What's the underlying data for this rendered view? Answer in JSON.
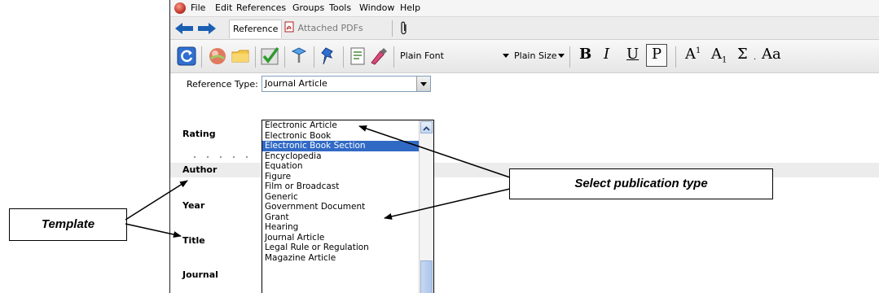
{
  "menubar": {
    "items": [
      "File",
      "Edit",
      "References",
      "Groups",
      "Tools",
      "Window",
      "Help"
    ]
  },
  "tabs": {
    "reference": "Reference",
    "attached_pdfs": "Attached PDFs"
  },
  "toolbar": {
    "font": "Plain Font",
    "size": "Plain Size",
    "bold": "B",
    "italic": "I",
    "underline": "U",
    "plain": "P",
    "superscript_base": "A",
    "superscript_mark": "1",
    "subscript_base": "A",
    "subscript_mark": "1",
    "symbol": "Σ",
    "case": "Aa"
  },
  "reference_type": {
    "label": "Reference Type:",
    "value": "Journal Article"
  },
  "fields": {
    "rating": "Rating",
    "author": "Author",
    "year": "Year",
    "title": "Title",
    "journal": "Journal"
  },
  "dropdown": {
    "options": [
      "Electronic Article",
      "Electronic Book",
      "Electronic Book Section",
      "Encyclopedia",
      "Equation",
      "Figure",
      "Film or Broadcast",
      "Generic",
      "Government Document",
      "Grant",
      "Hearing",
      "Journal Article",
      "Legal Rule or Regulation",
      "Magazine Article"
    ],
    "selected": "Electronic Book Section"
  },
  "callouts": {
    "select_type": "Select publication type",
    "template": "Template"
  },
  "colors": {
    "selection": "#316ac5",
    "arrow_blue": "#1a5fb4"
  }
}
